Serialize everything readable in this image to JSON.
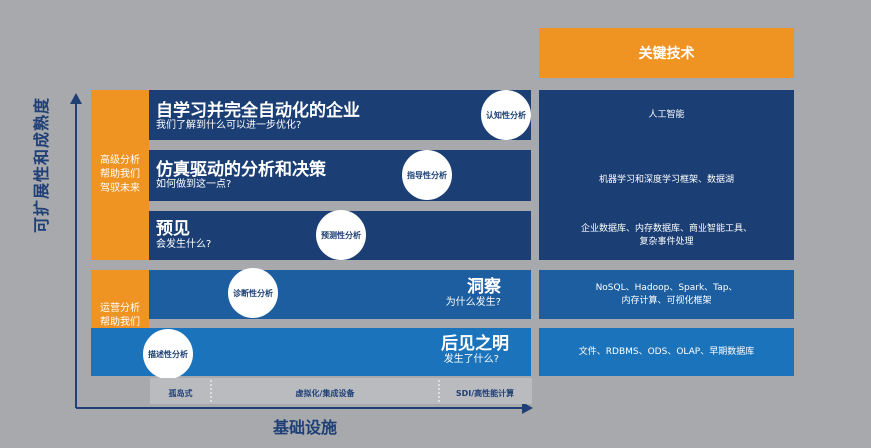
{
  "axes": {
    "y_title": "可扩展性和成熟度",
    "x_title": "基础设施"
  },
  "groups": {
    "advanced": "高级分析\n帮助我们\n驾驭未来",
    "operational": "运营分析\n帮助我们\n了解过去"
  },
  "rows": [
    {
      "title": "自学习并完全自动化的企业",
      "subtitle": "我们了解到什么可以进一步优化?",
      "badge": "认知性分析"
    },
    {
      "title": "仿真驱动的分析和决策",
      "subtitle": "如何做到这一点?",
      "badge": "指导性分析"
    },
    {
      "title": "预见",
      "subtitle": "会发生什么?",
      "badge": "预测性分析"
    },
    {
      "title": "洞察",
      "subtitle": "为什么发生?",
      "badge": "诊断性分析"
    },
    {
      "title": "后见之明",
      "subtitle": "发生了什么?",
      "badge": "描述性分析"
    }
  ],
  "technology": {
    "header": "关键技术",
    "items": [
      "人工智能",
      "机器学习和深度学习框架、数据湖",
      "企业数据库、内存数据库、商业智能工具、\n复杂事件处理",
      "NoSQL、Hadoop、Spark、Tap、\n内存计算、可视化框架",
      "文件、RDBMS、ODS、OLAP、早期数据库"
    ]
  },
  "infrastructure": [
    "孤岛式",
    "虚拟化/集成设备",
    "SDI/高性能计算"
  ],
  "colors": {
    "background": "#a7a9ac",
    "orange": "#ef9322",
    "navy": "#1b3f74",
    "mid_blue": "#1c5ea0",
    "light_blue": "#1b74bb"
  }
}
